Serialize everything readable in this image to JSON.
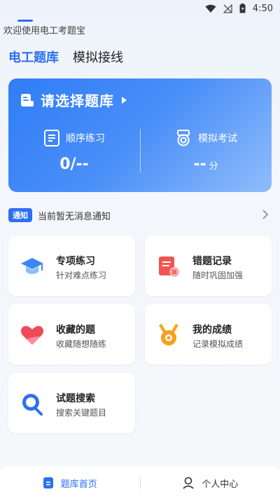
{
  "status_bar": {
    "time": "4:50"
  },
  "header": {
    "welcome": "欢迎使用电工考题宝"
  },
  "tabs": [
    {
      "label": "电工题库",
      "active": true
    },
    {
      "label": "模拟接线",
      "active": false
    }
  ],
  "hero": {
    "title": "请选择题库",
    "left": {
      "label": "顺序练习",
      "value": "0/--"
    },
    "right": {
      "label": "模拟考试",
      "value": "--",
      "unit": "分"
    }
  },
  "notice": {
    "badge": "通知",
    "text": "当前暂无消息通知"
  },
  "cards": [
    {
      "title": "专项练习",
      "sub": "针对难点练习",
      "icon": "graduation-cap-icon"
    },
    {
      "title": "错题记录",
      "sub": "随时巩固加强",
      "icon": "wrong-record-icon"
    },
    {
      "title": "收藏的题",
      "sub": "收藏随想随练",
      "icon": "heart-icon"
    },
    {
      "title": "我的成绩",
      "sub": "记录模拟成绩",
      "icon": "medal-icon"
    },
    {
      "title": "试题搜索",
      "sub": "搜索关键题目",
      "icon": "search-icon"
    }
  ],
  "bottom_nav": [
    {
      "label": "题库首页",
      "active": true,
      "icon": "question-bank-icon"
    },
    {
      "label": "个人中心",
      "active": false,
      "icon": "user-icon"
    }
  ],
  "colors": {
    "accent": "#2e6ff2"
  }
}
